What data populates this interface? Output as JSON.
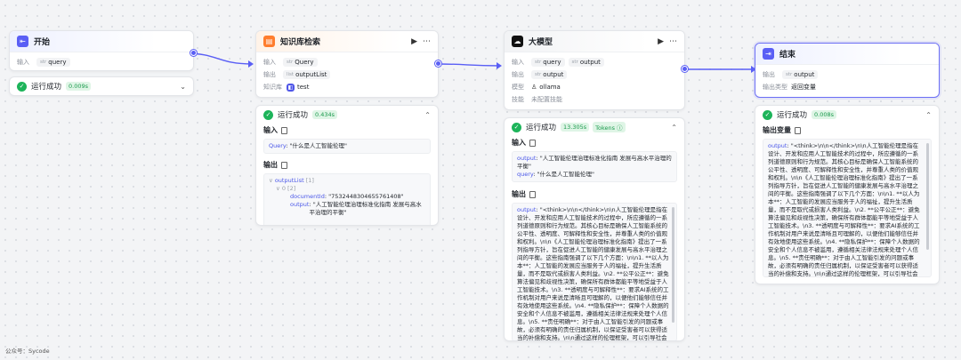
{
  "labels": {
    "input": "输入",
    "output": "输出",
    "run_status": "运行成功",
    "type_str": "str",
    "type_obj": "obj",
    "type_list": "list"
  },
  "start": {
    "title": "开始",
    "input_var": "query",
    "time": "0.009s"
  },
  "kb": {
    "title": "知识库检索",
    "input_var": "Query",
    "output_var": "outputList",
    "kb_label": "知识库",
    "kb_name": "test",
    "time": "0.434s",
    "input_section": "输入",
    "input_line_key": "Query",
    "input_line_val": ": \"什么是人工智能伦理\"",
    "output_section": "输出",
    "tree_root": "outputList",
    "tree_root_count": "[1]",
    "tree_item": "0",
    "tree_item_count": "[2]",
    "doc_key": "documentId",
    "doc_val": ": \"7532448304655761408\"",
    "out_key": "output",
    "out_val": ": \"人工智能伦理治理标准化指南 发展与高水平治理的平衡\""
  },
  "llm": {
    "title": "大模型",
    "input_var1": "query",
    "input_var2": "output",
    "output_var": "output",
    "model_label": "模型",
    "model_name": "ollama",
    "skill_label": "技能",
    "skill_val": "未配置技能",
    "time": "13.305s",
    "tokens": "Tokens ⓘ",
    "input_section": "输入",
    "in_output_key": "output",
    "in_output_val": ": \"人工智能伦理治理标准化指南 发展与高水平治理的平衡\"",
    "in_query_key": "query",
    "in_query_val": ": \"什么是人工智能伦理\"",
    "output_section": "输出",
    "out_key": "output",
    "out_val": ": \"<think>\\n\\n</think>\\n\\n人工智能伦理是指在设计、开发和应用人工智能技术的过程中，所应遵循的一系列道德原则和行为规范。其核心目标是确保人工智能系统的公平性、透明度、可解释性和安全性，并尊重人类的价值观和权利。\\n\\n《人工智能伦理治理标准化指南》提出了一系列指导方针，旨在促进人工智能的健康发展与高水平治理之间的平衡。这些指南强调了以下几个方面：\\n\\n1. **以人为本**：人工智能的发展应当服务于人的福祉，提升生活质量，而不是取代或损害人类利益。\\n2. **公平公正**：避免算法偏见和歧视性决策，确保所有群体都能平等地受益于人工智能技术。\\n3. **透明度与可解释性**：要求AI系统的工作机制对用户来说是清晰且可理解的，以便他们能够信任并有效地使用这些系统。\\n4. **隐私保护**：保障个人数据的安全和个人信息不被滥用，遵循相关法律法规来处理个人信息。\\n5. **责任明确**：对于由人工智能引发的问题或事故，必须有明确的责任归属机制，以保证受害者可以获得适当的补偿和支持。\\n\\n通过这样的伦理框架，可以引导社会各界共同参与构建一个负责任、可持续的人工智能生态系统。\""
  },
  "end": {
    "title": "结束",
    "output_var": "output",
    "out_type_label": "输出类型",
    "out_type_val": "返回变量",
    "time": "0.008s",
    "section": "输出变量",
    "out_key": "output",
    "out_val": ": \"<think>\\n\\n</think>\\n\\n人工智能伦理是指在设计、开发和应用人工智能技术的过程中，所应遵循的一系列道德原则和行为规范。其核心目标是确保人工智能系统的公平性、透明度、可解释性和安全性，并尊重人类的价值观和权利。\\n\\n《人工智能伦理治理标准化指南》提出了一系列指导方针，旨在促进人工智能的健康发展与高水平治理之间的平衡。这些指南强调了以下几个方面：\\n\\n1. **以人为本**：人工智能的发展应当服务于人的福祉，提升生活质量，而不是取代或损害人类利益。\\n2. **公平公正**：避免算法偏见和歧视性决策，确保所有群体都能平等地受益于人工智能技术。\\n3. **透明度与可解释性**：要求AI系统的工作机制对用户来说是清晰且可理解的，以便他们能够信任并有效地使用这些系统。\\n4. **隐私保护**：保障个人数据的安全和个人信息不被滥用，遵循相关法律法规来处理个人信息。\\n5. **责任明确**：对于由人工智能引发的问题或事故，必须有明确的责任归属机制，以保证受害者可以获得适当的补偿和支持。\\n\\n通过这样的伦理框架，可以引导社会各界共同参与构建一个负责任、可持续的人工智能生态系统。\""
  },
  "watermark": "公众号：Sycode",
  "colors": {
    "accent": "#5a5ff5",
    "success": "#1db45a",
    "knowledge": "#ff7d2d"
  }
}
